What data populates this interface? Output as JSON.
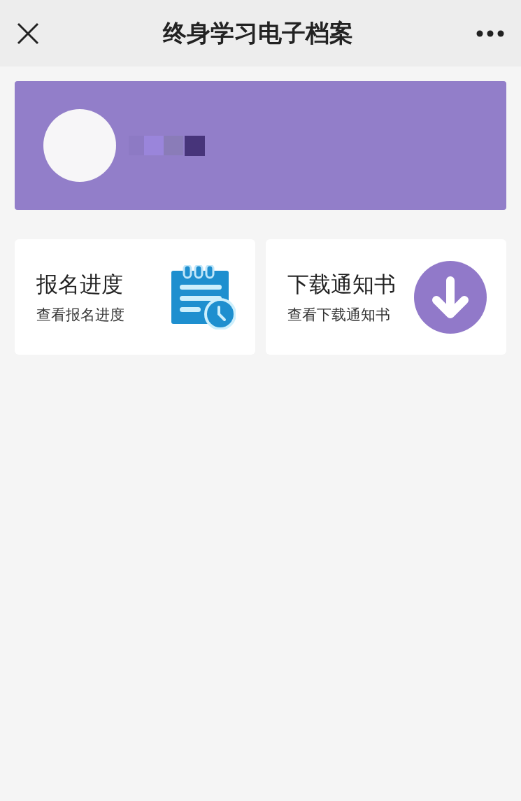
{
  "window": {
    "title": "终身学习电子档案"
  },
  "cards": [
    {
      "kind": "schedule",
      "title": "报名进度",
      "subtitle": "查看报名进度"
    },
    {
      "kind": "download",
      "title": "下载通知书",
      "subtitle": "查看下载通知书"
    }
  ]
}
